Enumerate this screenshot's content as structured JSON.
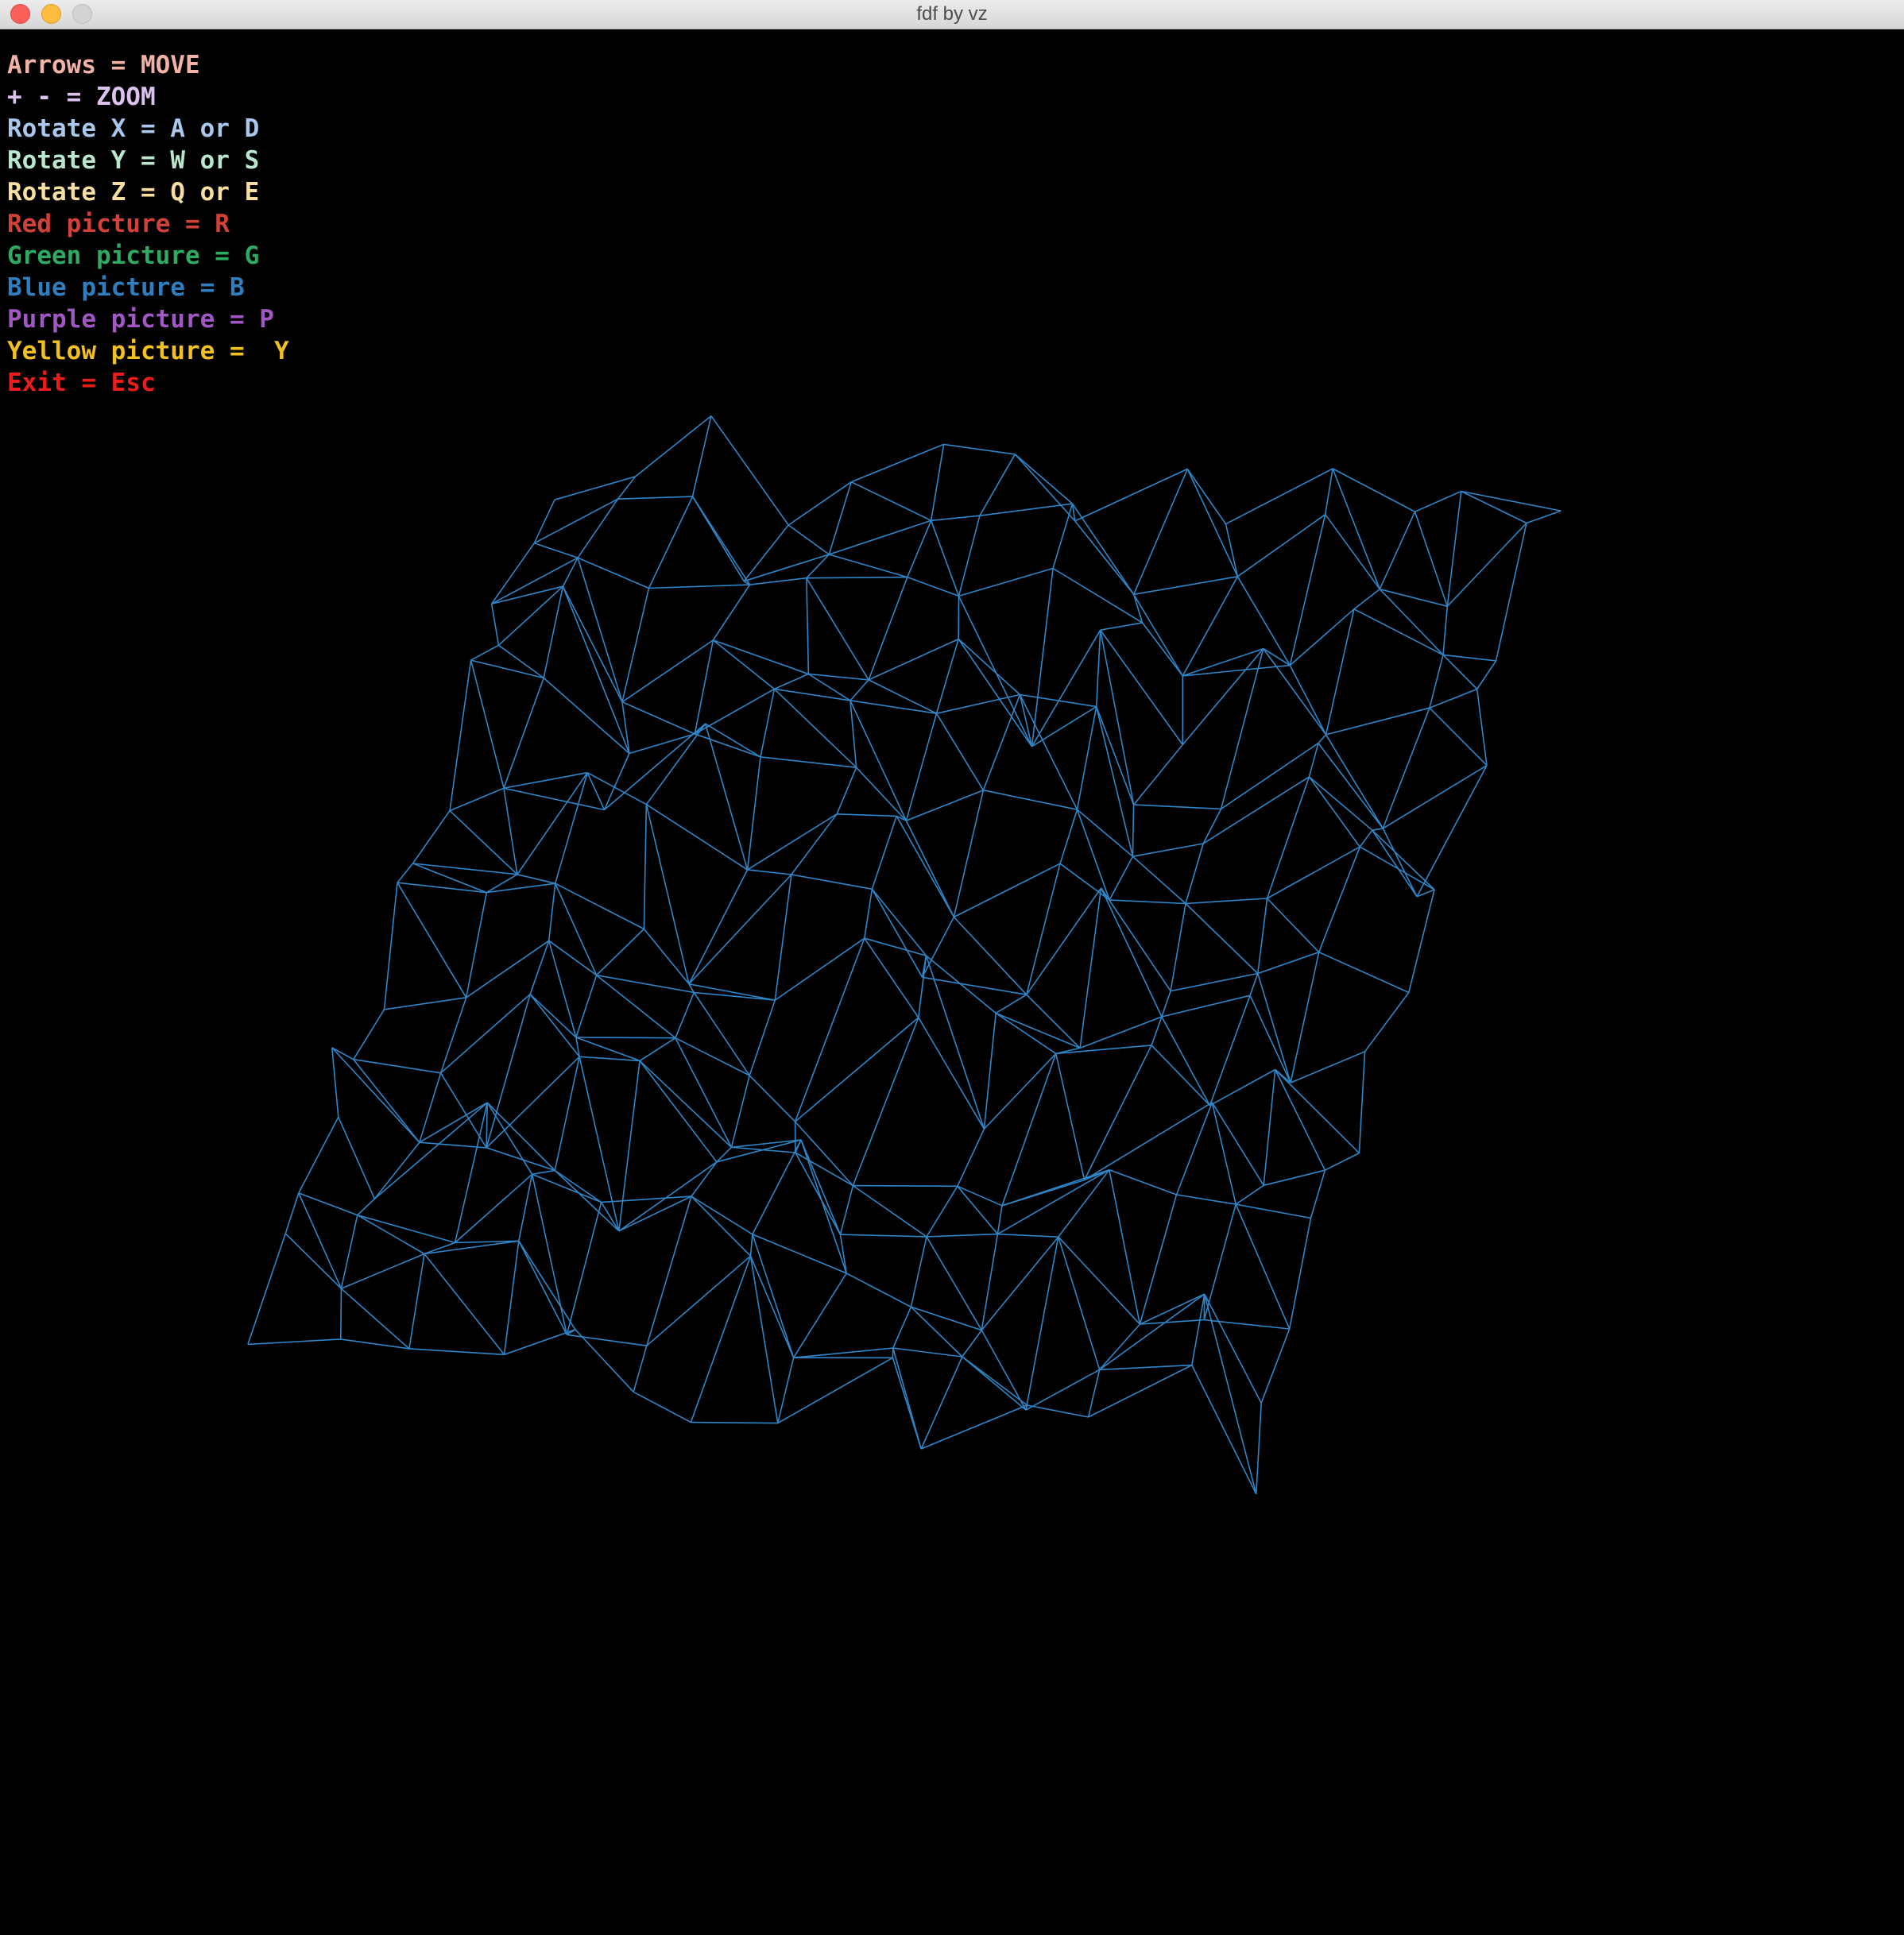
{
  "window": {
    "title": "fdf by vz"
  },
  "help": {
    "items": [
      {
        "text": "Arrows = MOVE",
        "color": "#f2b3a6"
      },
      {
        "text": "+ - = ZOOM",
        "color": "#dcc2ee"
      },
      {
        "text": "Rotate X = A or D",
        "color": "#a9c8ec"
      },
      {
        "text": "Rotate Y = W or S",
        "color": "#b9e6cc"
      },
      {
        "text": "Rotate Z = Q or E",
        "color": "#f6dfa0"
      },
      {
        "text": "Red picture = R",
        "color": "#d2403a"
      },
      {
        "text": "Green picture = G",
        "color": "#2eaa62"
      },
      {
        "text": "Blue picture = B",
        "color": "#2f7fc0"
      },
      {
        "text": "Purple picture = P",
        "color": "#a258c4"
      },
      {
        "text": "Yellow picture =  Y",
        "color": "#f2c01f"
      },
      {
        "text": "Exit = Esc",
        "color": "#ec1c1c"
      }
    ]
  },
  "wireframe": {
    "color": "#2f86c8",
    "rows": 15,
    "cols": 14
  }
}
